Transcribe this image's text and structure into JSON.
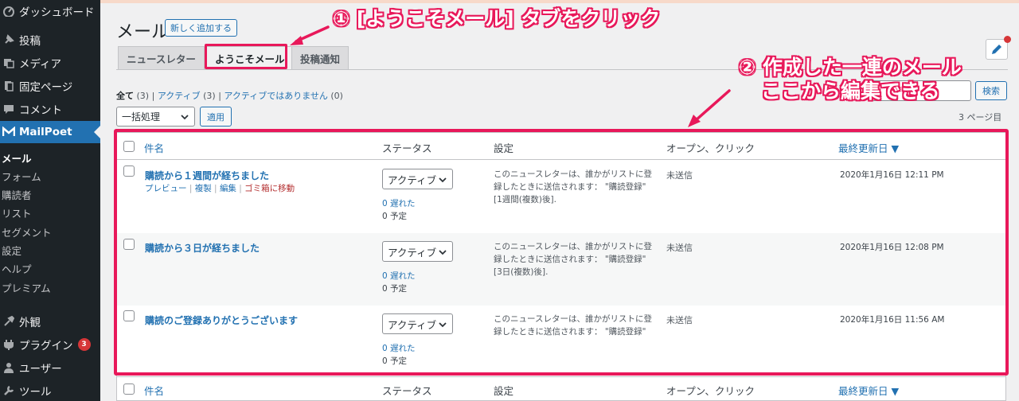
{
  "sidebar": {
    "items": [
      {
        "label": "ダッシュボード",
        "icon": "dashboard-icon"
      },
      {
        "label": "投稿",
        "icon": "pin-icon"
      },
      {
        "label": "メディア",
        "icon": "media-icon"
      },
      {
        "label": "固定ページ",
        "icon": "page-icon"
      },
      {
        "label": "コメント",
        "icon": "comment-icon"
      },
      {
        "label": "MailPoet",
        "icon": "mailpoet-icon"
      },
      {
        "label": "外観",
        "icon": "brush-icon"
      },
      {
        "label": "プラグイン",
        "icon": "plugin-icon",
        "badge": "3"
      },
      {
        "label": "ユーザー",
        "icon": "user-icon"
      },
      {
        "label": "ツール",
        "icon": "wrench-icon"
      }
    ],
    "submenu": [
      "メール",
      "フォーム",
      "購読者",
      "リスト",
      "セグメント",
      "設定",
      "ヘルプ",
      "プレミアム"
    ]
  },
  "header": {
    "title": "メール",
    "add_new_label": "新しく追加する"
  },
  "tabs": [
    "ニュースレター",
    "ようこそメール",
    "投稿通知"
  ],
  "filters": {
    "all_label": "全て",
    "all_count": "(3)",
    "active_label": "アクティブ",
    "active_count": "(3)",
    "inactive_label": "アクティブではありません",
    "inactive_count": "(0)",
    "separator": "|"
  },
  "bulk": {
    "select_value": "一括処理",
    "apply_label": "適用"
  },
  "search": {
    "button_label": "検索"
  },
  "pagination": {
    "count_text": "3 ページ目"
  },
  "table": {
    "columns": [
      "件名",
      "ステータス",
      "設定",
      "オープン、クリック",
      "最終更新日 ▼"
    ],
    "row_actions": [
      "プレビュー",
      "複製",
      "編集",
      "ゴミ箱に移動"
    ],
    "rows": [
      {
        "title": "購読から１週間が経ちました",
        "status": "アクティブ",
        "late": "0 遅れた",
        "scheduled": "0 予定",
        "settings": "このニュースレターは、誰かがリストに登録したときに送信されます： \"購読登録\" [1週間(複数)後].",
        "stats": "未送信",
        "updated": "2020年1月16日 12:11 PM"
      },
      {
        "title": "購読から３日が経ちました",
        "status": "アクティブ",
        "late": "0 遅れた",
        "scheduled": "0 予定",
        "settings": "このニュースレターは、誰かがリストに登録したときに送信されます： \"購読登録\" [3日(複数)後].",
        "stats": "未送信",
        "updated": "2020年1月16日 12:08 PM"
      },
      {
        "title": "購読のご登録ありがとうございます",
        "status": "アクティブ",
        "late": "0 遅れた",
        "scheduled": "0 予定",
        "settings": "このニュースレターは、誰かがリストに登録したときに送信されます： \"購読登録\"",
        "stats": "未送信",
        "updated": "2020年1月16日 11:56 AM"
      }
    ]
  },
  "annotations": {
    "step1": "① [ようこそメール] タブをクリック",
    "step2_line1": "② 作成した一連のメール",
    "step2_line2": "ここから編集できる"
  },
  "colors": {
    "accent": "#2271b1",
    "annotation": "#e8185a",
    "sidebar_bg": "#1d2327"
  }
}
